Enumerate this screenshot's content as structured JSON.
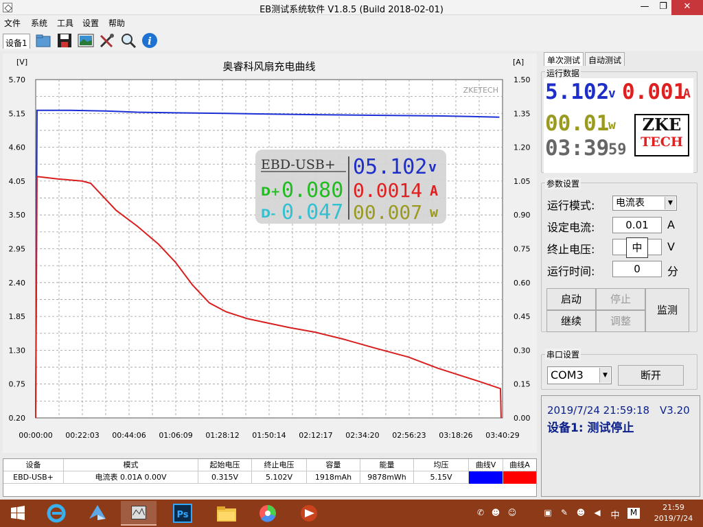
{
  "window": {
    "title": "EB测试系统软件 V1.8.5 (Build 2018-02-01)"
  },
  "menu": [
    "文件",
    "系统",
    "工具",
    "设置",
    "帮助"
  ],
  "toolbar": {
    "device_tab": "设备1",
    "icons": [
      "folder-icon",
      "save-icon",
      "image-icon",
      "tools-icon",
      "search-icon",
      "info-icon"
    ]
  },
  "chart_data": {
    "type": "line",
    "title": "奥睿科风扇充电曲线",
    "watermark": "ZKETECH",
    "left_unit": "[V]",
    "right_unit": "[A]",
    "ylim_left": [
      0.2,
      5.7
    ],
    "ylim_right": [
      0.0,
      1.5
    ],
    "yticks_left": [
      "5.70",
      "5.15",
      "4.60",
      "4.05",
      "3.50",
      "2.95",
      "2.40",
      "1.85",
      "1.30",
      "0.75",
      "0.20"
    ],
    "yticks_right": [
      "1.50",
      "1.35",
      "1.20",
      "1.05",
      "0.90",
      "0.75",
      "0.60",
      "0.45",
      "0.30",
      "0.15",
      "0.00"
    ],
    "xticks": [
      "00:00:00",
      "00:22:03",
      "00:44:06",
      "01:06:09",
      "01:28:12",
      "01:50:14",
      "02:12:17",
      "02:34:20",
      "02:56:23",
      "03:18:26",
      "03:40:29"
    ],
    "x_minutes": [
      0,
      22.05,
      44.1,
      66.15,
      88.2,
      110.23,
      132.28,
      154.33,
      176.38,
      198.43,
      220.48
    ],
    "series": [
      {
        "name": "曲线V",
        "axis": "left",
        "color": "#1a2fd6",
        "points": [
          [
            0,
            0.3
          ],
          [
            0.6,
            5.2
          ],
          [
            16,
            5.2
          ],
          [
            33,
            5.19
          ],
          [
            48,
            5.17
          ],
          [
            66,
            5.16
          ],
          [
            90,
            5.15
          ],
          [
            110,
            5.14
          ],
          [
            132,
            5.13
          ],
          [
            160,
            5.12
          ],
          [
            190,
            5.11
          ],
          [
            205,
            5.1
          ],
          [
            219,
            5.09
          ]
        ]
      },
      {
        "name": "曲线A",
        "axis": "right",
        "color": "#d81e1e",
        "points": [
          [
            0,
            0.0
          ],
          [
            0.6,
            1.07
          ],
          [
            10,
            1.06
          ],
          [
            22,
            1.05
          ],
          [
            26,
            1.04
          ],
          [
            30,
            1.0
          ],
          [
            38,
            0.92
          ],
          [
            48,
            0.85
          ],
          [
            58,
            0.77
          ],
          [
            66,
            0.69
          ],
          [
            74,
            0.59
          ],
          [
            82,
            0.51
          ],
          [
            90,
            0.47
          ],
          [
            100,
            0.44
          ],
          [
            110,
            0.42
          ],
          [
            120,
            0.4
          ],
          [
            132,
            0.38
          ],
          [
            145,
            0.35
          ],
          [
            160,
            0.31
          ],
          [
            176,
            0.27
          ],
          [
            190,
            0.22
          ],
          [
            200,
            0.19
          ],
          [
            210,
            0.16
          ],
          [
            219.5,
            0.13
          ],
          [
            219.8,
            0.0
          ]
        ]
      }
    ],
    "grid": true
  },
  "overlay": {
    "model": "EBD-USB+",
    "voltage": "05.102",
    "voltage_unit": "v",
    "dplus_label": "D+",
    "dplus_value": "0.080",
    "current": "0.0014",
    "current_unit": "A",
    "dminus_label": "D-",
    "dminus_value": "0.047",
    "power": "00.007",
    "power_unit": "w"
  },
  "right_tabs": [
    "单次测试",
    "自动测试"
  ],
  "run_data": {
    "group_label": "运行数据",
    "voltage": "5.102",
    "voltage_unit": "v",
    "current": "0.001",
    "current_unit": "A",
    "power": "00.01",
    "power_unit": "w",
    "time": "03:39",
    "time_sec": "59",
    "logo_line1": "ZKE",
    "logo_line2": "TECH"
  },
  "params": {
    "group_label": "参数设置",
    "mode_label": "运行模式:",
    "mode_value": "电流表",
    "current_label": "设定电流:",
    "current_value": "0.01",
    "current_unit": "A",
    "cutoff_label": "终止电压:",
    "cutoff_value": "",
    "cutoff_ime": "中",
    "cutoff_unit": "V",
    "time_label": "运行时间:",
    "time_value": "0",
    "time_unit": "分",
    "btn_start": "启动",
    "btn_stop": "停止",
    "btn_continue": "继续",
    "btn_adjust": "调整",
    "btn_monitor": "监测"
  },
  "serial": {
    "group_label": "串口设置",
    "port": "COM3",
    "btn_disconnect": "断开"
  },
  "status": {
    "datetime": "2019/7/24 21:59:18",
    "version": "V3.20",
    "message": "设备1: 测试停止"
  },
  "table": {
    "headers": [
      "设备",
      "模式",
      "起始电压",
      "终止电压",
      "容量",
      "能量",
      "均压",
      "曲线V",
      "曲线A"
    ],
    "rows": [
      [
        "EBD-USB+",
        "电流表  0.01A  0.00V",
        "0.315V",
        "5.102V",
        "1918mAh",
        "9878mWh",
        "5.15V",
        "",
        ""
      ]
    ],
    "curve_colors": [
      "#0000ff",
      "#ff0000"
    ]
  },
  "taskbar": {
    "apps": [
      "windows-start-icon",
      "ie-browser-icon",
      "feather-app-icon",
      "eb-tester-app-icon",
      "photoshop-icon",
      "file-explorer-icon",
      "color-picker-app-icon",
      "media-app-icon"
    ],
    "tray_ime": "中",
    "tray_ime2": "M",
    "time": "21:59",
    "date": "2019/7/24"
  }
}
